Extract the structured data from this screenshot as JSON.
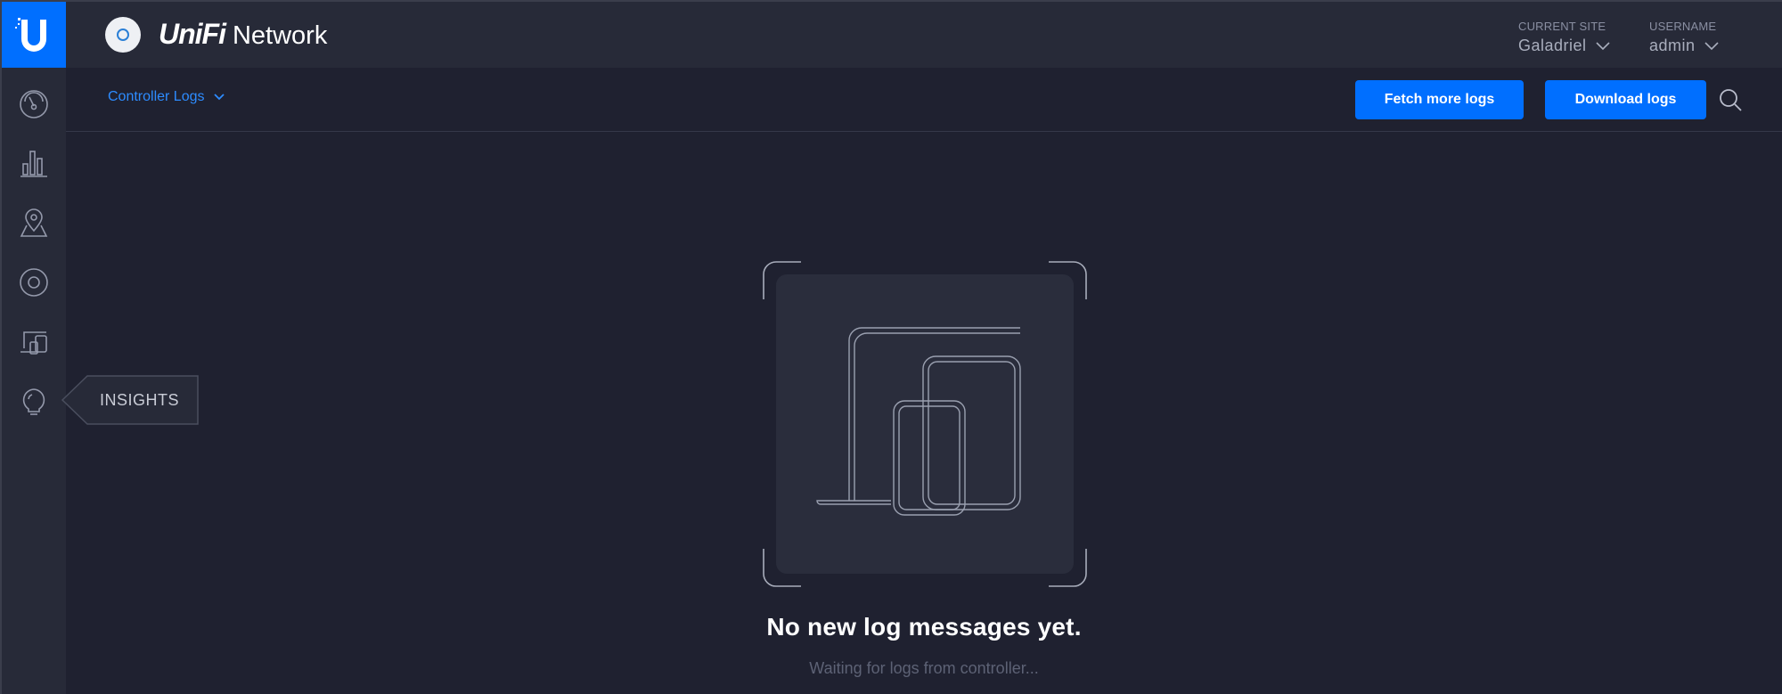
{
  "app": {
    "brand_unifi": "UniFi",
    "brand_network": "Network"
  },
  "header": {
    "current_site_caption": "CURRENT SITE",
    "current_site_value": "Galadriel",
    "username_caption": "USERNAME",
    "username_value": "admin"
  },
  "sidebar": {
    "items": [
      {
        "icon": "dashboard-icon"
      },
      {
        "icon": "statistics-icon"
      },
      {
        "icon": "map-icon"
      },
      {
        "icon": "devices-icon"
      },
      {
        "icon": "clients-icon"
      },
      {
        "icon": "insights-icon"
      }
    ],
    "tooltip": "INSIGHTS"
  },
  "toolbar": {
    "log_source": "Controller Logs",
    "fetch_label": "Fetch more logs",
    "download_label": "Download logs"
  },
  "empty_state": {
    "title": "No new log messages yet.",
    "subtitle": "Waiting for logs from controller..."
  },
  "colors": {
    "accent": "#006fff",
    "background": "#1f2130",
    "panel": "#272a38"
  }
}
